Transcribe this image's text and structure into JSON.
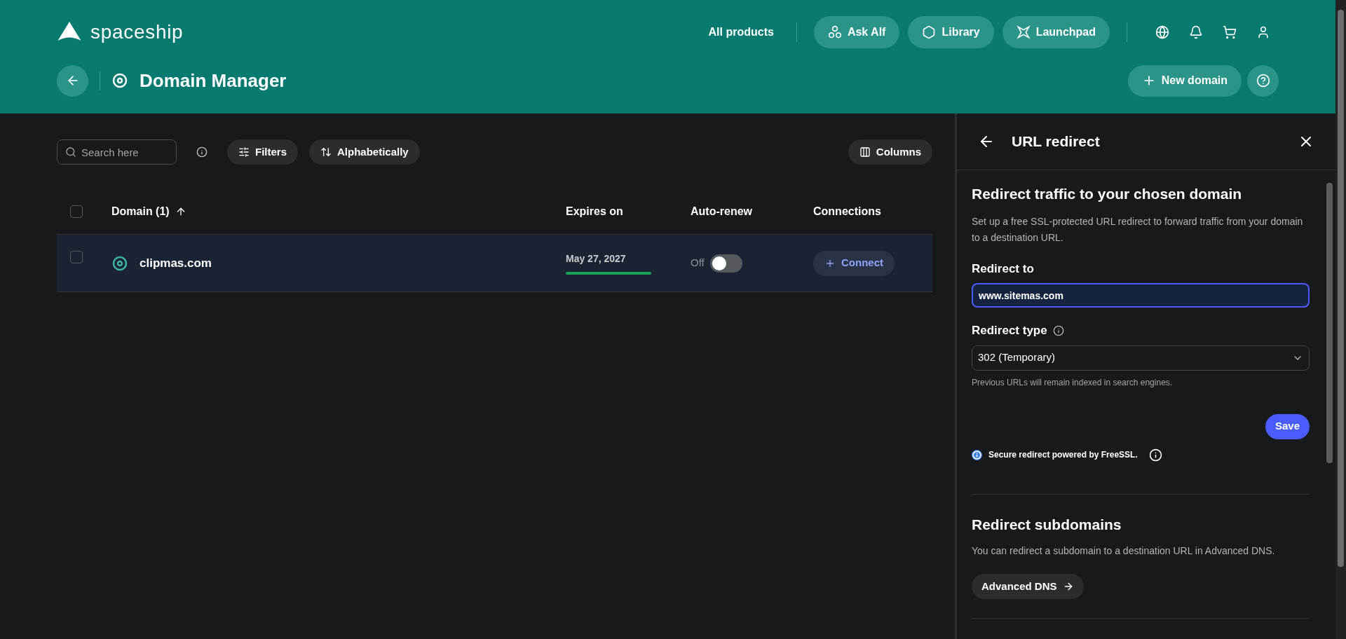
{
  "header": {
    "logo": "spaceship",
    "nav": [
      {
        "label": "All products",
        "kind": "text"
      },
      {
        "label": "Ask Alf",
        "kind": "pill"
      },
      {
        "label": "Library",
        "kind": "pill"
      },
      {
        "label": "Launchpad",
        "kind": "pill"
      }
    ],
    "page_title": "Domain Manager",
    "new_button": "New domain"
  },
  "toolbar": {
    "search": {
      "placeholder": "Search here"
    },
    "filters": "Filters",
    "sort": "Alphabetically",
    "columns": "Columns"
  },
  "table": {
    "columns": [
      "Domain (1)",
      "Expires on",
      "Auto-renew",
      "Connections"
    ],
    "header_checked": false,
    "rows": [
      {
        "checked": false,
        "highlighted": true,
        "domain": "clipmas.com",
        "expires": "May 27, 2027",
        "level": 1,
        "auto_renew": {
          "label": "Off",
          "on": false
        },
        "connect": "Connect"
      }
    ]
  },
  "panel": {
    "title": "URL redirect",
    "heading": "Redirect traffic to your chosen domain",
    "description": "Set up a free SSL-protected URL redirect to forward traffic from your domain to a destination URL.",
    "redirect_to": {
      "label": "Redirect to",
      "value": "www.sitemas.com"
    },
    "redirect_type": {
      "label": "Redirect type",
      "value": "302 (Temporary)",
      "hint": "Previous URLs will remain indexed in search engines."
    },
    "save": "Save",
    "notice": "Secure redirect powered by FreeSSL.",
    "subdomains": {
      "heading": "Redirect subdomains",
      "description": "You can redirect a subdomain to a destination URL in Advanced DNS.",
      "button": "Advanced DNS"
    }
  }
}
